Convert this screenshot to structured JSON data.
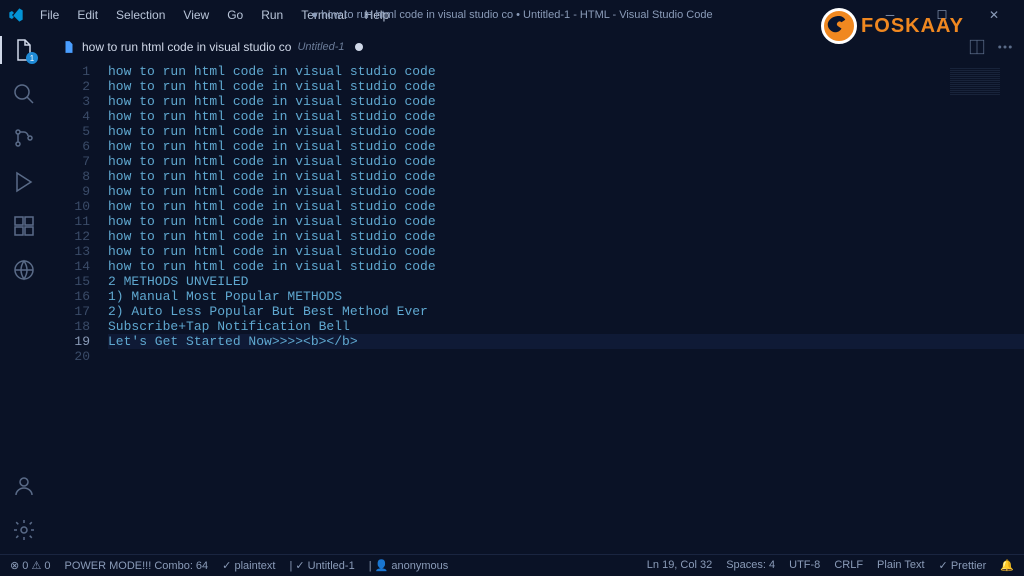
{
  "title": "● how to run html code in visual studio co • Untitled-1 - HTML - Visual Studio Code",
  "menu": [
    "File",
    "Edit",
    "Selection",
    "View",
    "Go",
    "Run",
    "Terminal",
    "Help"
  ],
  "tab": {
    "name": "how to run html code in visual studio co",
    "desc": "Untitled-1"
  },
  "logo": "FOSKAAY",
  "lines": [
    "how to run html code in visual studio code",
    "how to run html code in visual studio code",
    "how to run html code in visual studio code",
    "how to run html code in visual studio code",
    "how to run html code in visual studio code",
    "how to run html code in visual studio code",
    "how to run html code in visual studio code",
    "how to run html code in visual studio code",
    "how to run html code in visual studio code",
    "how to run html code in visual studio code",
    "how to run html code in visual studio code",
    "how to run html code in visual studio code",
    "how to run html code in visual studio code",
    "how to run html code in visual studio code",
    "2 METHODS UNVEILED",
    "1) Manual Most Popular METHODS",
    "2) Auto Less Popular But Best Method Ever",
    "Subscribe+Tap Notification Bell",
    "Let's Get Started Now>>>><b></b>",
    ""
  ],
  "currentLine": 19,
  "status": {
    "errors": "0",
    "warnings": "0",
    "power": "POWER MODE!!! Combo: 64",
    "lang": "plaintext",
    "file": "Untitled-1",
    "user": "anonymous",
    "pos": "Ln 19, Col 32",
    "spaces": "Spaces: 4",
    "enc": "UTF-8",
    "eol": "CRLF",
    "mode": "Plain Text",
    "prettier": "Prettier"
  },
  "badge": "1"
}
